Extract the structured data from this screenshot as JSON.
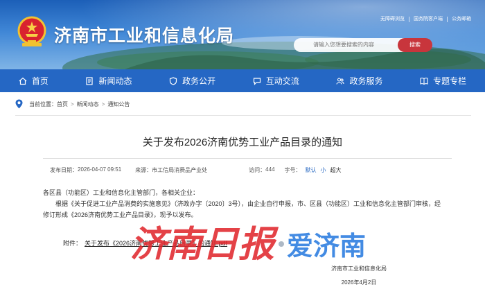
{
  "header": {
    "site_title": "济南市工业和信息化局",
    "top_links": [
      "无障碍浏览",
      "国务院客户端",
      "公务邮箱"
    ],
    "search_placeholder": "请输入您想要搜索的内容",
    "search_button": "搜索"
  },
  "nav": {
    "items": [
      {
        "label": "首页",
        "icon": "home-icon"
      },
      {
        "label": "新闻动态",
        "icon": "document-icon"
      },
      {
        "label": "政务公开",
        "icon": "shield-icon"
      },
      {
        "label": "互动交流",
        "icon": "chat-icon"
      },
      {
        "label": "政务服务",
        "icon": "people-icon"
      },
      {
        "label": "专题专栏",
        "icon": "book-icon"
      }
    ]
  },
  "breadcrumb": {
    "prefix": "当前位置：",
    "items": [
      "首页",
      "新闻动态",
      "通知公告"
    ],
    "separator": ">"
  },
  "article": {
    "title": "关于发布2026济南优势工业产品目录的通知",
    "publish_label": "发布日期：",
    "publish_date": "2026-04-07 09:51",
    "source_label": "来源：",
    "source": "市工信局消费品产业处",
    "visits_label": "访问：",
    "visits": "444",
    "fontsize_label": "字号：",
    "font_sizes": [
      "默认",
      "小",
      "超大"
    ],
    "salutation": "各区县（功能区）工业和信息化主管部门，各相关企业：",
    "paragraph": "根据《关于促进工业产品消费的实施意见》（济政办字〔2020〕3号），由企业自行申报，市、区县（功能区）工业和信息化主管部门审核，经修订形成《2026济南优势工业产品目录》，现予以发布。",
    "attachment_label": "附件：",
    "attachment_link": "关于发布《2026济南优势工业产品目录》的通知.pdf",
    "signature_org": "济南市工业和信息化局",
    "signature_date": "2026年4月2日"
  },
  "watermark": {
    "left_text": "济南日报",
    "right_text": "爱济南"
  },
  "colors": {
    "nav_bg": "#2567c4",
    "search_button": "#c8353c",
    "link_blue": "#2466c1",
    "watermark_red": "#e0282e",
    "watermark_blue": "#2f7ee0"
  }
}
